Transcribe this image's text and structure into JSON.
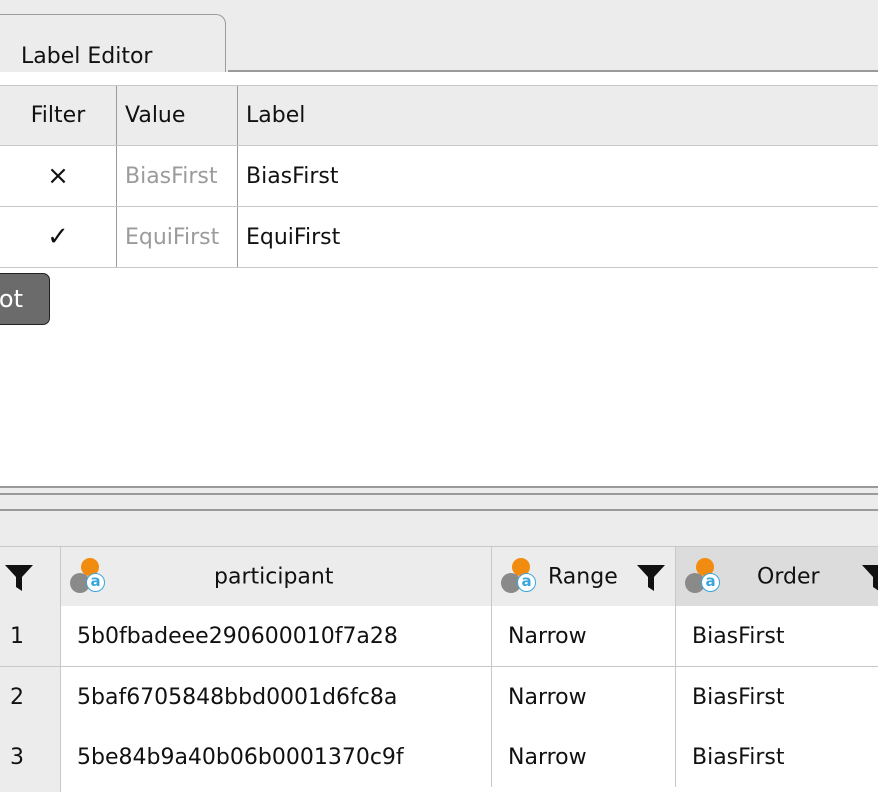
{
  "tab": {
    "label": "Label Editor"
  },
  "editor": {
    "columns": {
      "filter": "Filter",
      "value": "Value",
      "label": "Label"
    },
    "rows": [
      {
        "filter_icon": "cross-icon",
        "filter_glyph": "×",
        "value": "BiasFirst",
        "label": "BiasFirst"
      },
      {
        "filter_icon": "check-icon",
        "filter_glyph": "✓",
        "value": "EquiFirst",
        "label": "EquiFirst"
      }
    ],
    "partial_button": "ot"
  },
  "grid": {
    "columns": {
      "participant": "participant",
      "range": "Range",
      "order": "Order"
    },
    "column_icon": "nominal-text-variable-icon",
    "filter_icon": "funnel-filter-icon",
    "rows": [
      {
        "index": "1",
        "participant": "5b0fbadeee290600010f7a28",
        "range": "Narrow",
        "order": "BiasFirst"
      },
      {
        "index": "2",
        "participant": "5baf6705848bbd0001d6fc8a",
        "range": "Narrow",
        "order": "BiasFirst"
      },
      {
        "index": "3",
        "participant": "5be84b9a40b06b0001370c9f",
        "range": "Narrow",
        "order": "BiasFirst"
      }
    ]
  },
  "colors": {
    "orange": "#f28c10",
    "blue": "#3aa6dc",
    "grey": "#8a8a8a",
    "button": "#6b6b6b"
  }
}
